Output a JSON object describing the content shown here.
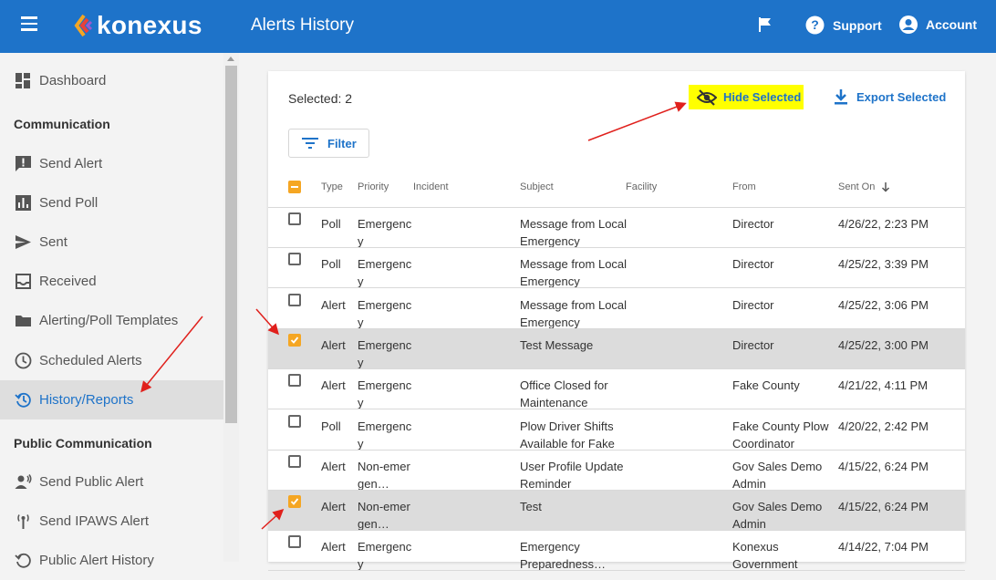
{
  "app": {
    "logo_text": "konexus",
    "page_title": "Alerts History",
    "support_label": "Support",
    "account_label": "Account"
  },
  "sidebar": {
    "dashboard": "Dashboard",
    "section_communication": "Communication",
    "send_alert": "Send Alert",
    "send_poll": "Send Poll",
    "sent": "Sent",
    "received": "Received",
    "templates": "Alerting/Poll Templates",
    "scheduled": "Scheduled Alerts",
    "history": "History/Reports",
    "section_public": "Public Communication",
    "send_public_alert": "Send Public Alert",
    "send_ipaws_alert": "Send IPAWS Alert",
    "public_history": "Public Alert History"
  },
  "toolbar": {
    "selected_text": "Selected: 2",
    "hide_selected": "Hide Selected",
    "export_selected": "Export Selected",
    "filter": "Filter"
  },
  "table": {
    "headers": {
      "type": "Type",
      "priority": "Priority",
      "incident": "Incident",
      "subject": "Subject",
      "facility": "Facility",
      "from": "From",
      "sent_on": "Sent On"
    },
    "rows": [
      {
        "checked": false,
        "type": "Poll",
        "priority": "Emergency",
        "subject": "Message from Local Emergency Management",
        "from": "Director",
        "sent_on": "4/26/22, 2:23 PM"
      },
      {
        "checked": false,
        "type": "Poll",
        "priority": "Emergency",
        "subject": "Message from Local Emergency Management",
        "from": "Director",
        "sent_on": "4/25/22, 3:39 PM"
      },
      {
        "checked": false,
        "type": "Alert",
        "priority": "Emergency",
        "subject": "Message from Local Emergency Management",
        "from": "Director",
        "sent_on": "4/25/22, 3:06 PM"
      },
      {
        "checked": true,
        "type": "Alert",
        "priority": "Emergency",
        "subject": "Test Message",
        "from": "Director",
        "sent_on": "4/25/22, 3:00 PM"
      },
      {
        "checked": false,
        "type": "Alert",
        "priority": "Emergency",
        "subject": "Office Closed for Maintenance",
        "from": "Fake County",
        "sent_on": "4/21/22, 4:11 PM"
      },
      {
        "checked": false,
        "type": "Poll",
        "priority": "Emergency",
        "subject": "Plow Driver Shifts Available for Fake County",
        "from": "Fake County Plow Coordinator",
        "sent_on": "4/20/22, 2:42 PM"
      },
      {
        "checked": false,
        "type": "Alert",
        "priority": "Non-emergen…",
        "subject": "User Profile Update Reminder",
        "from": "Gov Sales Demo Admin",
        "sent_on": "4/15/22, 6:24 PM"
      },
      {
        "checked": true,
        "type": "Alert",
        "priority": "Non-emergen…",
        "subject": "Test",
        "from": "Gov Sales Demo Admin",
        "sent_on": "4/15/22, 6:24 PM"
      },
      {
        "checked": false,
        "type": "Alert",
        "priority": "Emergency",
        "subject": "Emergency Preparedness…",
        "from": "Konexus Government Demo…",
        "sent_on": "4/14/22, 7:04 PM"
      }
    ]
  },
  "colors": {
    "brand_blue": "#1e73c9",
    "highlight_yellow": "#ffff00",
    "checkbox_orange": "#f5a623",
    "annotation_red": "#e0201c"
  }
}
